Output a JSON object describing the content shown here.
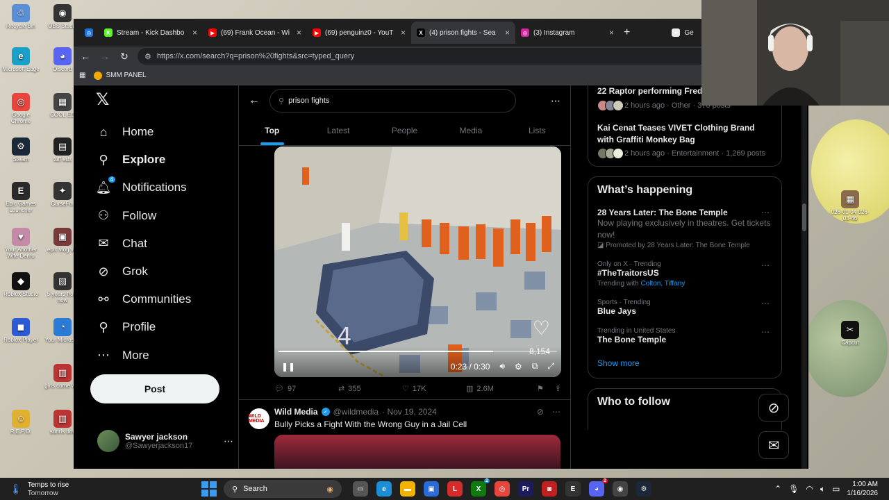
{
  "desktop": {
    "icons": [
      {
        "label": "Recycle Bin",
        "color": "#5a8fd6",
        "glyph": "♲"
      },
      {
        "label": "OBS Studio",
        "color": "#333333",
        "glyph": "◉"
      },
      {
        "label": "Microsoft Edge",
        "color": "#1aa0c9",
        "glyph": "e"
      },
      {
        "label": "Discord",
        "color": "#5865f2",
        "glyph": "◕"
      },
      {
        "label": "Google Chrome",
        "color": "#e8453c",
        "glyph": "◎"
      },
      {
        "label": "COOL ED",
        "color": "#444444",
        "glyph": "▦"
      },
      {
        "label": "Steam",
        "color": "#1b2838",
        "glyph": "⚙"
      },
      {
        "label": "tuff edit",
        "color": "#222222",
        "glyph": "▤"
      },
      {
        "label": "Epic Games Launcher",
        "color": "#2a2a2a",
        "glyph": "E"
      },
      {
        "label": "CurseFor",
        "color": "#333333",
        "glyph": "✦"
      },
      {
        "label": "Your Another Wife Demo",
        "color": "#c48aa8",
        "glyph": "♥"
      },
      {
        "label": "epic vlog vid",
        "color": "#7a3a3a",
        "glyph": "▣"
      },
      {
        "label": "Roblox Studio",
        "color": "#111111",
        "glyph": "◆"
      },
      {
        "label": "5 years from now",
        "color": "#333333",
        "glyph": "▧"
      },
      {
        "label": "Roblox Player",
        "color": "#2d5bd6",
        "glyph": "◼"
      },
      {
        "label": "Your Microsoft",
        "color": "#2a7bd6",
        "glyph": "◔"
      },
      {
        "label": "girls come wor",
        "color": "#b33",
        "glyph": "▥"
      },
      {
        "label": "R.E.P.O.",
        "color": "#e0b030",
        "glyph": "☺"
      },
      {
        "label": "sunris dov",
        "color": "#b33",
        "glyph": "▥"
      }
    ],
    "right_icons": [
      {
        "label": "026-01-04 026-03-46",
        "color": "#8a6a4a",
        "glyph": "▦"
      },
      {
        "label": "Capcut",
        "color": "#111111",
        "glyph": "✂"
      }
    ]
  },
  "browser": {
    "tabs": [
      {
        "title": "",
        "fav_color": "#1a73e8",
        "fav_glyph": "◎",
        "active": false
      },
      {
        "title": "Stream - Kick Dashbo",
        "fav_color": "#53fc18",
        "fav_glyph": "K",
        "active": false
      },
      {
        "title": "(69) Frank Ocean - Wi",
        "fav_color": "#ff0000",
        "fav_glyph": "▶",
        "active": false
      },
      {
        "title": "(69) penguinz0 - YouT",
        "fav_color": "#ff0000",
        "fav_glyph": "▶",
        "active": false
      },
      {
        "title": "(4) prison fights - Sea",
        "fav_color": "#000000",
        "fav_glyph": "X",
        "active": true
      },
      {
        "title": "(3) Instagram",
        "fav_color": "#d6249f",
        "fav_glyph": "◎",
        "active": false
      },
      {
        "title": "Ge",
        "fav_color": "#e8eaed",
        "fav_glyph": "✦",
        "active": false
      }
    ],
    "new_tab": "+",
    "url": "https://x.com/search?q=prison%20fights&src=typed_query",
    "bookmark": "SMM PANEL"
  },
  "nav": {
    "logo": "𝕏",
    "items": [
      {
        "label": "Home",
        "icon": "⌂",
        "bold": false
      },
      {
        "label": "Explore",
        "icon": "⚲",
        "bold": true
      },
      {
        "label": "Notifications",
        "icon": "🔔︎",
        "bold": false,
        "badge": "4"
      },
      {
        "label": "Follow",
        "icon": "⚇",
        "bold": false
      },
      {
        "label": "Chat",
        "icon": "✉",
        "bold": false
      },
      {
        "label": "Grok",
        "icon": "⊘",
        "bold": false
      },
      {
        "label": "Communities",
        "icon": "⚯",
        "bold": false
      },
      {
        "label": "Profile",
        "icon": "⚲",
        "bold": false
      },
      {
        "label": "More",
        "icon": "⋯",
        "bold": false
      }
    ],
    "post_label": "Post",
    "account": {
      "name": "Sawyer jackson",
      "handle": "@Sawyerjackson17",
      "more": "⋯"
    }
  },
  "search": {
    "query": "prison fights",
    "tabs": [
      "Top",
      "Latest",
      "People",
      "Media",
      "Lists"
    ],
    "active_tab": "Top"
  },
  "video": {
    "time": "0:23 / 0:30",
    "progress": 0.77,
    "likes_overlay": "8,154"
  },
  "tweet1_actions": {
    "replies": "97",
    "reposts": "355",
    "likes": "17K",
    "views": "2.6M"
  },
  "tweet2": {
    "avatar_text": "WILD MEDIA",
    "name": "Wild Media",
    "handle": "@wildmedia",
    "date": "· Nov 19, 2024",
    "text": "Bully Picks a Fight With the Wrong Guy in a Jail Cell"
  },
  "right": {
    "trend_top": {
      "title": "22 Raptor performing Fred",
      "meta": "2 hours ago · Other · 376 posts"
    },
    "trend_kai": {
      "title": "Kai Cenat Teases VIVET Clothing Brand with Graffiti Monkey Bag",
      "meta": "2 hours ago · Entertainment · 1,269 posts"
    },
    "happening_title": "What’s happening",
    "happening": [
      {
        "context": "",
        "title": "28 Years Later: The Bone Temple",
        "desc": "Now playing exclusively in theatres. Get tickets now!",
        "promo": "Promoted by 28 Years Later: The Bone Temple"
      },
      {
        "context": "Only on X · Trending",
        "title": "#TheTraitorsUS",
        "with_label": "Trending with",
        "with_links": "Colton, Tiffany"
      },
      {
        "context": "Sports · Trending",
        "title": "Blue Jays"
      },
      {
        "context": "Trending in United States",
        "title": "The Bone Temple"
      }
    ],
    "show_more": "Show more",
    "who_to_follow": "Who to follow"
  },
  "taskbar": {
    "weather_title": "Temps to rise",
    "weather_sub": "Tomorrow",
    "search_label": "Search",
    "time": "1:00 AM",
    "date": "1/16/2026"
  }
}
